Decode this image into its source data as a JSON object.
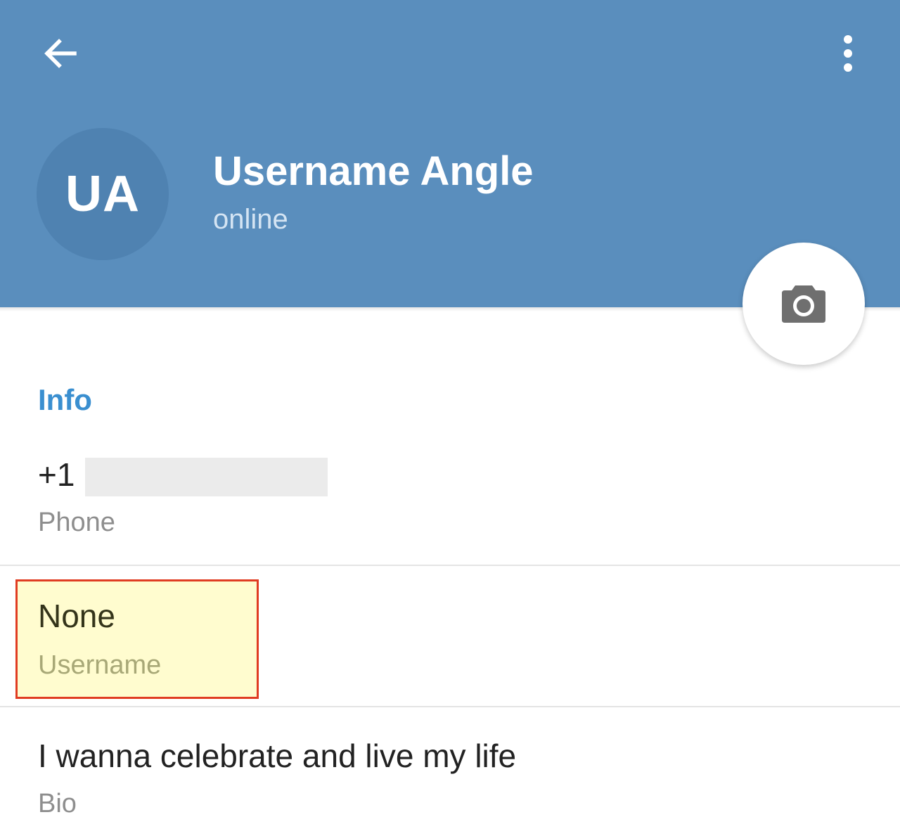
{
  "colors": {
    "header_bg": "#5a8ebd",
    "avatar_bg": "#4f82b1",
    "accent": "#3a8fd0",
    "highlight_bg": "#fffccf",
    "highlight_border": "#e03c22"
  },
  "header": {
    "back_icon": "arrow-left-icon",
    "menu_icon": "more-vertical-icon"
  },
  "profile": {
    "initials": "UA",
    "name": "Username Angle",
    "status": "online",
    "camera_icon": "camera-icon"
  },
  "info": {
    "section_title": "Info",
    "phone": {
      "value": "+1",
      "label": "Phone"
    },
    "username": {
      "value": "None",
      "label": "Username"
    },
    "bio": {
      "value": "I wanna celebrate and live my life",
      "label": "Bio"
    }
  }
}
